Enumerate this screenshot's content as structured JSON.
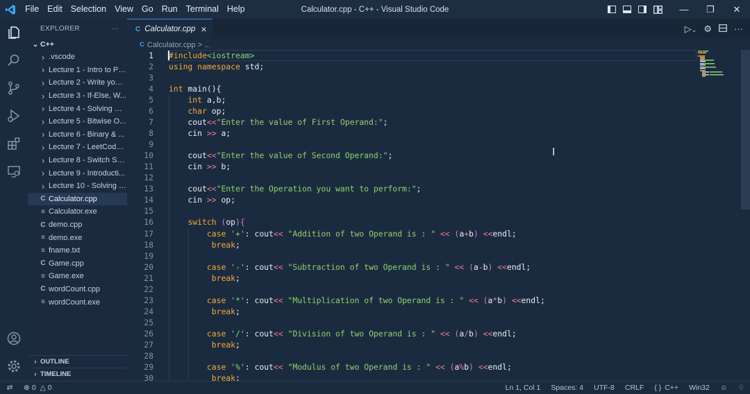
{
  "titlebar": {
    "menu": [
      "File",
      "Edit",
      "Selection",
      "View",
      "Go",
      "Run",
      "Terminal",
      "Help"
    ],
    "window_title": "Calculator.cpp - C++ - Visual Studio Code"
  },
  "explorer": {
    "header": "EXPLORER",
    "more": "···",
    "root": "C++",
    "items": [
      {
        "label": ".vscode",
        "kind": "folder"
      },
      {
        "label": "Lecture 1 - Intro to Pr...",
        "kind": "folder"
      },
      {
        "label": "Lecture 2 - Write your...",
        "kind": "folder"
      },
      {
        "label": "Lecture 3 - If-Else, W...",
        "kind": "folder"
      },
      {
        "label": "Lecture 4 - Solving Pa...",
        "kind": "folder"
      },
      {
        "label": "Lecture 5 - Bitwise O...",
        "kind": "folder"
      },
      {
        "label": "Lecture 6 - Binary & ...",
        "kind": "folder"
      },
      {
        "label": "Lecture 7 - LeetCode ...",
        "kind": "folder"
      },
      {
        "label": "Lecture 8 - Switch Sta...",
        "kind": "folder"
      },
      {
        "label": "Lecture 9 - Introducti...",
        "kind": "folder"
      },
      {
        "label": "Lecture 10 - Solving L...",
        "kind": "folder"
      },
      {
        "label": "Calculator.cpp",
        "kind": "cpp",
        "selected": true
      },
      {
        "label": "Calculator.exe",
        "kind": "exe"
      },
      {
        "label": "demo.cpp",
        "kind": "cpp"
      },
      {
        "label": "demo.exe",
        "kind": "exe"
      },
      {
        "label": "fname.txt",
        "kind": "exe"
      },
      {
        "label": "Game.cpp",
        "kind": "cpp"
      },
      {
        "label": "Game.exe",
        "kind": "exe"
      },
      {
        "label": "wordCount.cpp",
        "kind": "cpp"
      },
      {
        "label": "wordCount.exe",
        "kind": "exe"
      }
    ],
    "outline": "OUTLINE",
    "timeline": "TIMELINE"
  },
  "editor": {
    "tab_label": "Calculator.cpp",
    "breadcrumb": "Calculator.cpp > ...",
    "lines": [
      [
        [
          "pp",
          "#include"
        ],
        [
          "inc",
          "<iostream>"
        ]
      ],
      [
        [
          "k",
          "using namespace"
        ],
        [
          "t",
          " std;"
        ]
      ],
      [],
      [
        [
          "k",
          "int"
        ],
        [
          "t",
          " main(){"
        ]
      ],
      [
        [
          "t",
          "    "
        ],
        [
          "k",
          "int"
        ],
        [
          "t",
          " a,b;"
        ]
      ],
      [
        [
          "t",
          "    "
        ],
        [
          "k",
          "char"
        ],
        [
          "t",
          " op;"
        ]
      ],
      [
        [
          "t",
          "    cout"
        ],
        [
          "o",
          "<<"
        ],
        [
          "s",
          "\"Enter the value of First Operand:\""
        ],
        [
          "t",
          ";"
        ]
      ],
      [
        [
          "t",
          "    cin "
        ],
        [
          "o",
          ">>"
        ],
        [
          "t",
          " a;"
        ]
      ],
      [],
      [
        [
          "t",
          "    cout"
        ],
        [
          "o",
          "<<"
        ],
        [
          "s",
          "\"Enter the value of Second Operand:\""
        ],
        [
          "t",
          ";"
        ]
      ],
      [
        [
          "t",
          "    cin "
        ],
        [
          "o",
          ">>"
        ],
        [
          "t",
          " b;"
        ]
      ],
      [],
      [
        [
          "t",
          "    cout"
        ],
        [
          "o",
          "<<"
        ],
        [
          "s",
          "\"Enter the Operation you want to perform:\""
        ],
        [
          "t",
          ";"
        ]
      ],
      [
        [
          "t",
          "    cin "
        ],
        [
          "o",
          ">>"
        ],
        [
          "t",
          " op;"
        ]
      ],
      [],
      [
        [
          "t",
          "    "
        ],
        [
          "k",
          "switch"
        ],
        [
          "t",
          " "
        ],
        [
          "p",
          "("
        ],
        [
          "t",
          "op"
        ],
        [
          "p",
          ")"
        ],
        [
          "p",
          "{"
        ]
      ],
      [
        [
          "t",
          "        "
        ],
        [
          "k",
          "case"
        ],
        [
          "t",
          " "
        ],
        [
          "s",
          "'+'"
        ],
        [
          "t",
          ": cout"
        ],
        [
          "o",
          "<<"
        ],
        [
          "t",
          " "
        ],
        [
          "s",
          "\"Addition of two Operand is : \""
        ],
        [
          "t",
          " "
        ],
        [
          "o",
          "<<"
        ],
        [
          "t",
          " "
        ],
        [
          "p",
          "("
        ],
        [
          "t",
          "a"
        ],
        [
          "o",
          "+"
        ],
        [
          "t",
          "b"
        ],
        [
          "p",
          ")"
        ],
        [
          "t",
          " "
        ],
        [
          "o",
          "<<"
        ],
        [
          "t",
          "endl;"
        ]
      ],
      [
        [
          "t",
          "         "
        ],
        [
          "k",
          "break"
        ],
        [
          "t",
          ";"
        ]
      ],
      [],
      [
        [
          "t",
          "        "
        ],
        [
          "k",
          "case"
        ],
        [
          "t",
          " "
        ],
        [
          "s",
          "'-'"
        ],
        [
          "t",
          ": cout"
        ],
        [
          "o",
          "<<"
        ],
        [
          "t",
          " "
        ],
        [
          "s",
          "\"Subtraction of two Operand is : \""
        ],
        [
          "t",
          " "
        ],
        [
          "o",
          "<<"
        ],
        [
          "t",
          " "
        ],
        [
          "p",
          "("
        ],
        [
          "t",
          "a"
        ],
        [
          "o",
          "-"
        ],
        [
          "t",
          "b"
        ],
        [
          "p",
          ")"
        ],
        [
          "t",
          " "
        ],
        [
          "o",
          "<<"
        ],
        [
          "t",
          "endl;"
        ]
      ],
      [
        [
          "t",
          "         "
        ],
        [
          "k",
          "break"
        ],
        [
          "t",
          ";"
        ]
      ],
      [],
      [
        [
          "t",
          "        "
        ],
        [
          "k",
          "case"
        ],
        [
          "t",
          " "
        ],
        [
          "s",
          "'*'"
        ],
        [
          "t",
          ": cout"
        ],
        [
          "o",
          "<<"
        ],
        [
          "t",
          " "
        ],
        [
          "s",
          "\"Multiplication of two Operand is : \""
        ],
        [
          "t",
          " "
        ],
        [
          "o",
          "<<"
        ],
        [
          "t",
          " "
        ],
        [
          "p",
          "("
        ],
        [
          "t",
          "a"
        ],
        [
          "o",
          "*"
        ],
        [
          "t",
          "b"
        ],
        [
          "p",
          ")"
        ],
        [
          "t",
          " "
        ],
        [
          "o",
          "<<"
        ],
        [
          "t",
          "endl;"
        ]
      ],
      [
        [
          "t",
          "         "
        ],
        [
          "k",
          "break"
        ],
        [
          "t",
          ";"
        ]
      ],
      [],
      [
        [
          "t",
          "        "
        ],
        [
          "k",
          "case"
        ],
        [
          "t",
          " "
        ],
        [
          "s",
          "'/'"
        ],
        [
          "t",
          ": cout"
        ],
        [
          "o",
          "<<"
        ],
        [
          "t",
          " "
        ],
        [
          "s",
          "\"Division of two Operand is : \""
        ],
        [
          "t",
          " "
        ],
        [
          "o",
          "<<"
        ],
        [
          "t",
          " "
        ],
        [
          "p",
          "("
        ],
        [
          "t",
          "a"
        ],
        [
          "o",
          "/"
        ],
        [
          "t",
          "b"
        ],
        [
          "p",
          ")"
        ],
        [
          "t",
          " "
        ],
        [
          "o",
          "<<"
        ],
        [
          "t",
          "endl;"
        ]
      ],
      [
        [
          "t",
          "         "
        ],
        [
          "k",
          "break"
        ],
        [
          "t",
          ";"
        ]
      ],
      [],
      [
        [
          "t",
          "        "
        ],
        [
          "k",
          "case"
        ],
        [
          "t",
          " "
        ],
        [
          "s",
          "'%'"
        ],
        [
          "t",
          ": cout"
        ],
        [
          "o",
          "<<"
        ],
        [
          "t",
          " "
        ],
        [
          "s",
          "\"Modulus of two Operand is : \""
        ],
        [
          "t",
          " "
        ],
        [
          "o",
          "<<"
        ],
        [
          "t",
          " "
        ],
        [
          "p",
          "("
        ],
        [
          "t",
          "a"
        ],
        [
          "o",
          "%"
        ],
        [
          "t",
          "b"
        ],
        [
          "p",
          ")"
        ],
        [
          "t",
          " "
        ],
        [
          "o",
          "<<"
        ],
        [
          "t",
          "endl;"
        ]
      ],
      [
        [
          "t",
          "         "
        ],
        [
          "k",
          "break"
        ],
        [
          "t",
          ";"
        ]
      ]
    ]
  },
  "status": {
    "errors": "0",
    "warnings": "0",
    "position": "Ln 1, Col 1",
    "spaces": "Spaces: 4",
    "encoding": "UTF-8",
    "eol": "CRLF",
    "lang_braces": "{ }",
    "language": "C++",
    "platform": "Win32"
  },
  "colors": {
    "keyword": "#f2a93b",
    "string": "#8fd16e",
    "operator": "#f07f93",
    "paren": "#cf7bd6",
    "accent": "#3c8ee0"
  }
}
